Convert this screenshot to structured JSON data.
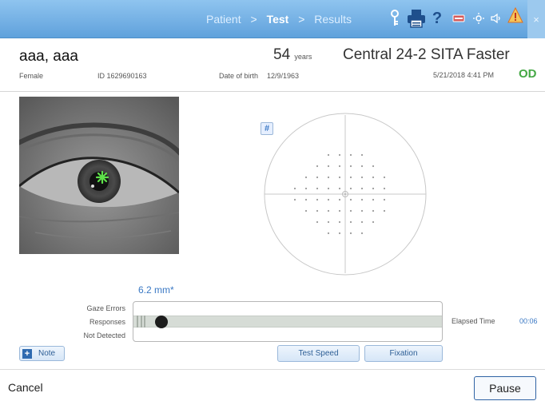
{
  "nav": {
    "crumbs": [
      "Patient",
      "Test",
      "Results"
    ],
    "separator": ">"
  },
  "toolbar": {
    "icons": [
      "key-icon",
      "printer-icon",
      "help-icon",
      "keyboard-icon",
      "brightness-icon",
      "volume-icon",
      "alert-icon",
      "close-icon"
    ],
    "help_label": "?",
    "close_label": "×"
  },
  "patient": {
    "name": "aaa, aaa",
    "sex": "Female",
    "id": "ID 1629690163",
    "dob_label": "Date of birth",
    "dob": "12/9/1963",
    "age": "54",
    "age_unit": "years"
  },
  "test": {
    "name": "Central 24-2   SITA Faster",
    "datetime": "5/21/2018 4:41 PM",
    "eye": "OD",
    "grid_button": "#"
  },
  "monitor": {
    "pupil": "6.2 mm*",
    "labels": [
      "Gaze Errors",
      "Responses",
      "Not Detected"
    ],
    "elapsed_label": "Elapsed Time",
    "elapsed_value": "00:06"
  },
  "actions": {
    "note": "Note",
    "note_icon": "+",
    "test_speed": "Test Speed",
    "fixation": "Fixation",
    "cancel": "Cancel",
    "pause": "Pause"
  },
  "colors": {
    "header_bar": "#6aaae0",
    "accent": "#3a78c4",
    "eye_label": "#45a845",
    "fixation_marker": "#5ee14a"
  }
}
